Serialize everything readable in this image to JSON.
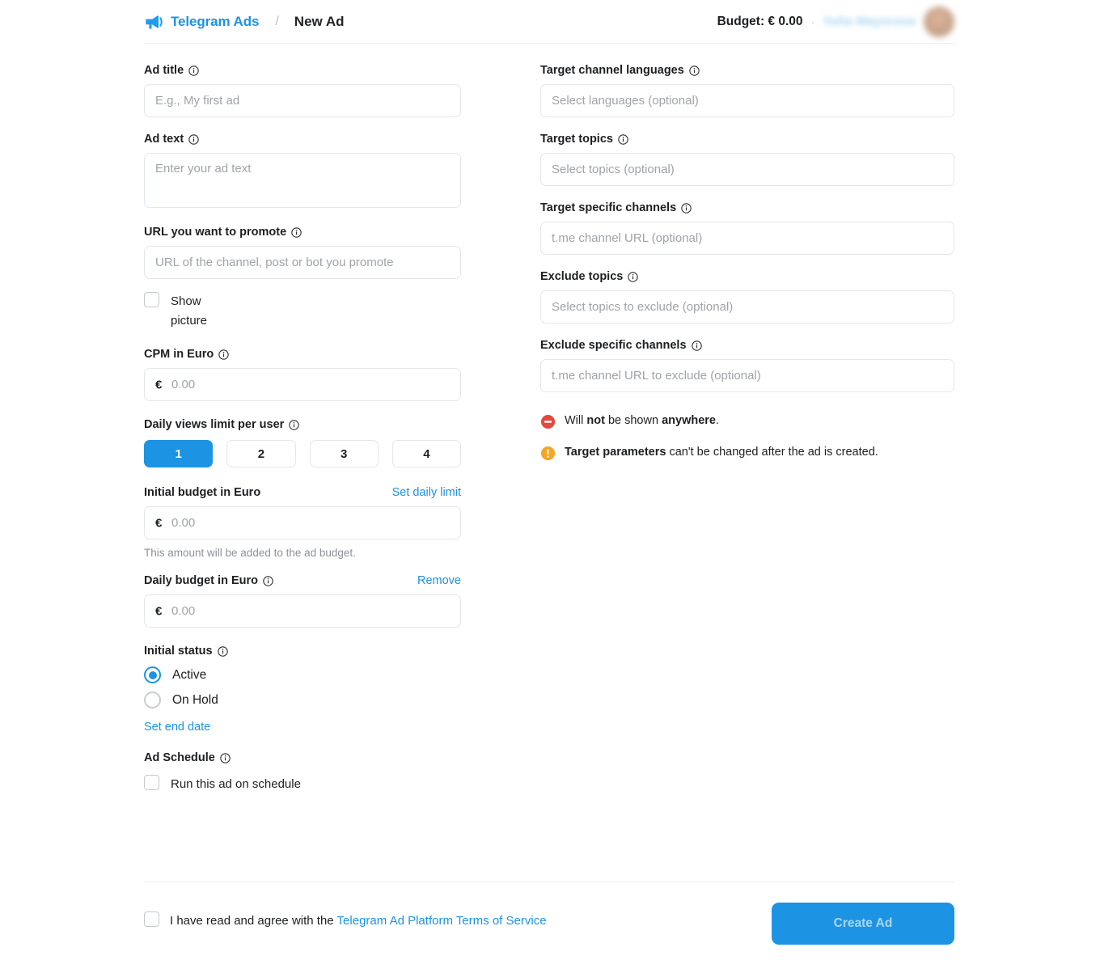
{
  "header": {
    "logo_icon": "megaphone-icon",
    "brand": "Telegram Ads",
    "separator": "/",
    "current": "New Ad",
    "budget": "Budget: € 0.00",
    "dot": "·",
    "user_name": "Yulia Mayorova",
    "avatar": "user-avatar"
  },
  "left": {
    "ad_title": {
      "label": "Ad title",
      "placeholder": "E.g., My first ad",
      "value": ""
    },
    "ad_text": {
      "label": "Ad text",
      "placeholder": "Enter your ad text",
      "value": ""
    },
    "url": {
      "label": "URL you want to promote",
      "placeholder": "URL of the channel, post or bot you promote",
      "value": ""
    },
    "show_picture": {
      "label": "Show picture",
      "checked": false
    },
    "cpm": {
      "label": "CPM in Euro",
      "currency": "€",
      "placeholder": "0.00",
      "value": ""
    },
    "views_limit": {
      "label": "Daily views limit per user",
      "options": [
        "1",
        "2",
        "3",
        "4"
      ],
      "selected": "1"
    },
    "initial_budget": {
      "label": "Initial budget in Euro",
      "action": "Set daily limit",
      "currency": "€",
      "placeholder": "0.00",
      "value": "",
      "hint": "This amount will be added to the ad budget."
    },
    "daily_budget": {
      "label": "Daily budget in Euro",
      "action": "Remove",
      "currency": "€",
      "placeholder": "0.00",
      "value": ""
    },
    "initial_status": {
      "label": "Initial status",
      "options": [
        "Active",
        "On Hold"
      ],
      "selected": "Active"
    },
    "set_end_date": "Set end date",
    "ad_schedule": {
      "label": "Ad Schedule",
      "checkbox_label": "Run this ad on schedule",
      "checked": false
    }
  },
  "right": {
    "target_languages": {
      "label": "Target channel languages",
      "placeholder": "Select languages (optional)",
      "value": ""
    },
    "target_topics": {
      "label": "Target topics",
      "placeholder": "Select topics (optional)",
      "value": ""
    },
    "target_channels": {
      "label": "Target specific channels",
      "placeholder": "t.me channel URL (optional)",
      "value": ""
    },
    "exclude_topics": {
      "label": "Exclude topics",
      "placeholder": "Select topics to exclude (optional)",
      "value": ""
    },
    "exclude_channels": {
      "label": "Exclude specific channels",
      "placeholder": "t.me channel URL to exclude (optional)",
      "value": ""
    },
    "notices": [
      {
        "icon": "no-entry-icon",
        "color": "#e5483e",
        "html": "Will <b>not</b> be shown <b>anywhere</b>."
      },
      {
        "icon": "warning-icon",
        "color": "#f5a623",
        "html": "<b>Target parameters</b> can't be changed after the ad is created."
      }
    ]
  },
  "footer": {
    "terms_prefix": "I have read and agree with the ",
    "terms_link": "Telegram Ad Platform Terms of Service",
    "terms_checked": false,
    "create_button": "Create Ad"
  },
  "colors": {
    "accent": "#1c93e3",
    "danger": "#e5483e",
    "warning": "#f5a623",
    "border": "#e4e7ea",
    "placeholder": "#9fa3a8"
  }
}
